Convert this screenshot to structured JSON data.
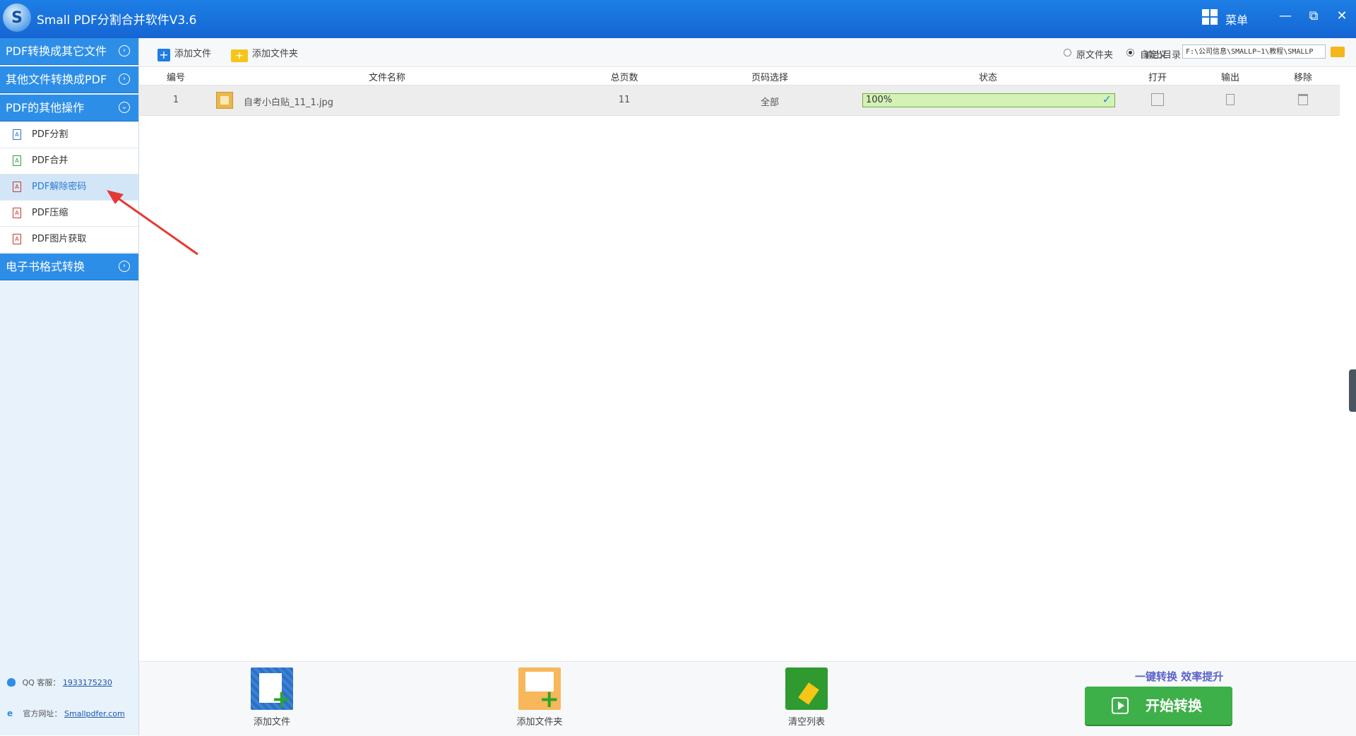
{
  "app": {
    "title": "Small PDF分割合并软件V3.6",
    "logo_letter": "S",
    "menu_label": "菜单"
  },
  "window_controls": {
    "minimize": "—",
    "restore": "⧉",
    "close": "✕"
  },
  "sidebar": {
    "categories": [
      {
        "label": "PDF转换成其它文件",
        "chevron": "›"
      },
      {
        "label": "其他文件转换成PDF",
        "chevron": "›"
      },
      {
        "label": "PDF的其他操作",
        "chevron": "⌄"
      },
      {
        "label": "电子书格式转换",
        "chevron": "›"
      }
    ],
    "items": [
      {
        "label": "PDF分割",
        "color": "#2a6fc9"
      },
      {
        "label": "PDF合并",
        "color": "#2e9a3a"
      },
      {
        "label": "PDF解除密码",
        "color": "#c0392b"
      },
      {
        "label": "PDF压缩",
        "color": "#c0392b"
      },
      {
        "label": "PDF图片获取",
        "color": "#c0392b"
      }
    ],
    "footer": {
      "qq_label": "QQ 客服：",
      "qq_value": "1933175230",
      "site_label": "官方网址：",
      "site_value": "Smallpdfer.com"
    }
  },
  "toolbar": {
    "add_file": "添加文件",
    "add_folder": "添加文件夹",
    "output_label": "输出目录：",
    "radio_original": "原文件夹",
    "radio_custom": "自定义",
    "output_path": "F:\\公司信息\\SMALLP~1\\教程\\SMALLP"
  },
  "table": {
    "headers": {
      "index": "编号",
      "name": "文件名称",
      "pages": "总页数",
      "range": "页码选择",
      "status": "状态",
      "open": "打开",
      "export": "输出",
      "remove": "移除"
    },
    "rows": [
      {
        "index": "1",
        "name": "自考小白贴_11_1.jpg",
        "pages": "11",
        "range": "全部",
        "status": "100%",
        "progress": 1.0
      }
    ]
  },
  "bottom": {
    "add_file": "添加文件",
    "add_folder": "添加文件夹",
    "clear_list": "清空列表",
    "slogan": "一键转换  效率提升",
    "start": "开始转换"
  },
  "colors": {
    "titlebar": "#1d7fe6",
    "sidebar_category": "#2d8ee8",
    "start_button": "#3eb049",
    "progress_fill": "#d4f2b6"
  }
}
